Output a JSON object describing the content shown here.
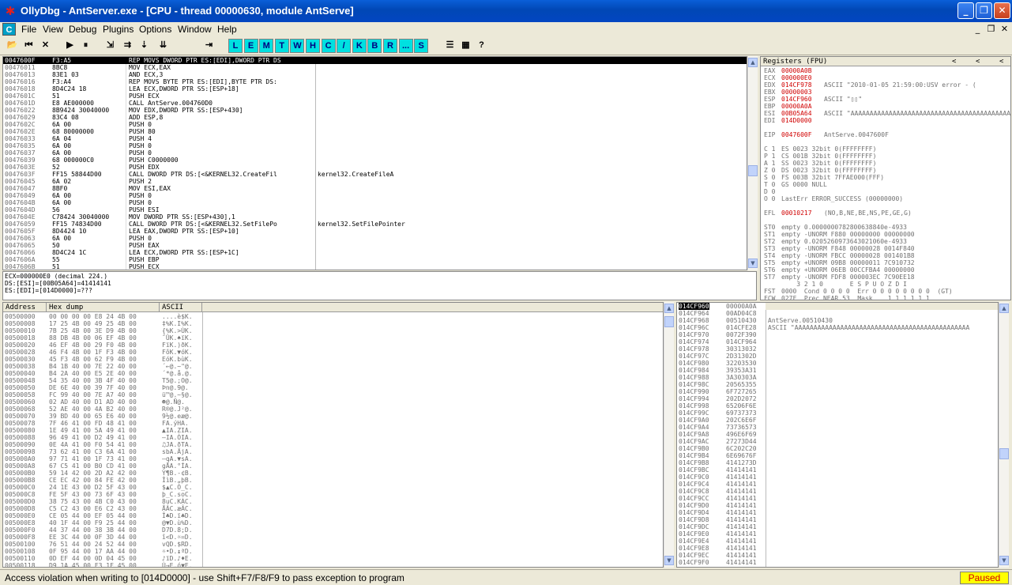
{
  "window": {
    "title": "OllyDbg - AntServer.exe - [CPU - thread 00000630, module AntServe]"
  },
  "menu": {
    "mdi_icon": "C",
    "items": [
      "File",
      "View",
      "Debug",
      "Plugins",
      "Options",
      "Window",
      "Help"
    ]
  },
  "toolbar": {
    "icon_buttons": [
      {
        "name": "open-icon",
        "glyph": "📂"
      },
      {
        "name": "restart-icon",
        "glyph": "⏮"
      },
      {
        "name": "close-program-icon",
        "glyph": "✕"
      },
      {
        "name": "run-icon",
        "glyph": "▶"
      },
      {
        "name": "pause-icon",
        "glyph": "⏸"
      },
      {
        "name": "step-into-icon",
        "glyph": "⇲"
      },
      {
        "name": "step-over-icon",
        "glyph": "⇉"
      },
      {
        "name": "trace-into-icon",
        "glyph": "⇣"
      },
      {
        "name": "trace-over-icon",
        "glyph": "⇊"
      },
      {
        "name": "execute-till-return-icon",
        "glyph": "⇥"
      }
    ],
    "window_buttons": [
      "L",
      "E",
      "M",
      "T",
      "W",
      "H",
      "C",
      "/",
      "K",
      "B",
      "R",
      "...",
      "S"
    ],
    "right_icons": [
      {
        "name": "list-icon",
        "glyph": "☰"
      },
      {
        "name": "appearance-icon",
        "glyph": "▦"
      },
      {
        "name": "help-icon",
        "glyph": "?"
      }
    ]
  },
  "disasm": {
    "rows": [
      [
        "0047600F",
        "F3:A5",
        "REP MOVS DWORD PTR ES:[EDI],DWORD PTR DS",
        ""
      ],
      [
        "00476011",
        "8BC8",
        "MOV ECX,EAX",
        ""
      ],
      [
        "00476013",
        "83E1 03",
        "AND ECX,3",
        ""
      ],
      [
        "00476016",
        "F3:A4",
        "REP MOVS BYTE PTR ES:[EDI],BYTE PTR DS:",
        ""
      ],
      [
        "00476018",
        "8D4C24 18",
        "LEA ECX,DWORD PTR SS:[ESP+18]",
        ""
      ],
      [
        "0047601C",
        "51",
        "PUSH ECX",
        ""
      ],
      [
        "0047601D",
        "E8 AE000000",
        "CALL AntServe.004760D0",
        ""
      ],
      [
        "00476022",
        "8B9424 30040000",
        "MOV EDX,DWORD PTR SS:[ESP+430]",
        ""
      ],
      [
        "00476029",
        "83C4 08",
        "ADD ESP,8",
        ""
      ],
      [
        "0047602C",
        "6A 00",
        "PUSH 0",
        ""
      ],
      [
        "0047602E",
        "68 80000000",
        "PUSH 80",
        ""
      ],
      [
        "00476033",
        "6A 04",
        "PUSH 4",
        ""
      ],
      [
        "00476035",
        "6A 00",
        "PUSH 0",
        ""
      ],
      [
        "00476037",
        "6A 00",
        "PUSH 0",
        ""
      ],
      [
        "00476039",
        "68 000000C0",
        "PUSH C0000000",
        ""
      ],
      [
        "0047603E",
        "52",
        "PUSH EDX",
        ""
      ],
      [
        "0047603F",
        "FF15 58844D00",
        "CALL DWORD PTR DS:[<&KERNEL32.CreateFil",
        "kernel32.CreateFileA"
      ],
      [
        "00476045",
        "6A 02",
        "PUSH 2",
        ""
      ],
      [
        "00476047",
        "8BF0",
        "MOV ESI,EAX",
        ""
      ],
      [
        "00476049",
        "6A 00",
        "PUSH 0",
        ""
      ],
      [
        "0047604B",
        "6A 00",
        "PUSH 0",
        ""
      ],
      [
        "0047604D",
        "56",
        "PUSH ESI",
        ""
      ],
      [
        "0047604E",
        "C78424 30040000",
        "MOV DWORD PTR SS:[ESP+430],1",
        ""
      ],
      [
        "00476059",
        "FF15 74834D00",
        "CALL DWORD PTR DS:[<&KERNEL32.SetFilePo",
        "kernel32.SetFilePointer"
      ],
      [
        "0047605F",
        "8D4424 10",
        "LEA EAX,DWORD PTR SS:[ESP+10]",
        ""
      ],
      [
        "00476063",
        "6A 00",
        "PUSH 0",
        ""
      ],
      [
        "00476065",
        "50",
        "PUSH EAX",
        ""
      ],
      [
        "00476066",
        "8D4C24 1C",
        "LEA ECX,DWORD PTR SS:[ESP+1C]",
        ""
      ],
      [
        "0047606A",
        "55",
        "PUSH EBP",
        ""
      ],
      [
        "0047606B",
        "51",
        "PUSH ECX",
        ""
      ]
    ]
  },
  "info": {
    "lines": [
      "ECX=000000E0 (decimal 224.)",
      "DS:[ESI]=[00B05A64]=41414141",
      "ES:[EDI]=[014D0000]=???"
    ]
  },
  "registers": {
    "title": "Registers (FPU)",
    "nav": [
      "<",
      "<",
      "<"
    ],
    "lines": [
      {
        "label": "EAX",
        "value": "00000A0B",
        "comment": "",
        "red": true
      },
      {
        "label": "ECX",
        "value": "000000E0",
        "comment": "",
        "red": true
      },
      {
        "label": "EDX",
        "value": "014CF978",
        "comment": "ASCII \"2010-01-05 21:59:00:USV error - (",
        "red": true
      },
      {
        "label": "EBX",
        "value": "00000003",
        "comment": "",
        "red": true
      },
      {
        "label": "ESP",
        "value": "014CF960",
        "comment": "ASCII \"▯▯\"",
        "red": true
      },
      {
        "label": "EBP",
        "value": "00000A0A",
        "comment": "",
        "red": true
      },
      {
        "label": "ESI",
        "value": "00B05A64",
        "comment": "ASCII \"AAAAAAAAAAAAAAAAAAAAAAAAAAAAAAAAAAAAAAAAAAAA",
        "red": true
      },
      {
        "label": "EDI",
        "value": "014D0000",
        "comment": "",
        "red": true
      },
      {
        "label": "",
        "value": "",
        "comment": "",
        "red": false
      },
      {
        "label": "EIP",
        "value": "0047600F",
        "comment": "AntServe.0047600F",
        "red": true
      },
      {
        "label": "",
        "value": "",
        "comment": "",
        "red": false
      },
      {
        "label": "C 1",
        "value": "",
        "comment": "ES 0023 32bit 0(FFFFFFFF)",
        "red": false
      },
      {
        "label": "P 1",
        "value": "",
        "comment": "CS 001B 32bit 0(FFFFFFFF)",
        "red": false
      },
      {
        "label": "A 1",
        "value": "",
        "comment": "SS 0023 32bit 0(FFFFFFFF)",
        "red": false
      },
      {
        "label": "Z 0",
        "value": "",
        "comment": "DS 0023 32bit 0(FFFFFFFF)",
        "red": false
      },
      {
        "label": "S 0",
        "value": "",
        "comment": "FS 003B 32bit 7FFAE000(FFF)",
        "red": false
      },
      {
        "label": "T 0",
        "value": "",
        "comment": "GS 0000 NULL",
        "red": false
      },
      {
        "label": "D 0",
        "value": "",
        "comment": "",
        "red": false
      },
      {
        "label": "O 0",
        "value": "",
        "comment": "LastErr ERROR_SUCCESS (00000000)",
        "red": false
      },
      {
        "label": "",
        "value": "",
        "comment": "",
        "red": false
      },
      {
        "label": "EFL",
        "value": "00010217",
        "comment": "(NO,B,NE,BE,NS,PE,GE,G)",
        "red": true
      },
      {
        "label": "",
        "value": "",
        "comment": "",
        "red": false
      },
      {
        "label": "ST0",
        "value": "",
        "comment": "empty 0.0000000782800638840e-4933",
        "red": false
      },
      {
        "label": "ST1",
        "value": "",
        "comment": "empty -UNORM F880 00000000 00000000",
        "red": false
      },
      {
        "label": "ST2",
        "value": "",
        "comment": "empty 0.0205260973643021060e-4933",
        "red": false
      },
      {
        "label": "ST3",
        "value": "",
        "comment": "empty -UNORM F848 00000028 0014F840",
        "red": false
      },
      {
        "label": "ST4",
        "value": "",
        "comment": "empty -UNORM FBCC 00000028 001401B8",
        "red": false
      },
      {
        "label": "ST5",
        "value": "",
        "comment": "empty +UNORM 09B8 00000011 7C910732",
        "red": false
      },
      {
        "label": "ST6",
        "value": "",
        "comment": "empty +UNORM 06EB 00CCFBA4 00000000",
        "red": false
      },
      {
        "label": "ST7",
        "value": "",
        "comment": "empty -UNORM FDF8 000003EC 7C90EE18",
        "red": false
      },
      {
        "label": "",
        "value": "",
        "comment": "    3 2 1 0       E S P U O Z D I",
        "red": false
      },
      {
        "label": "FST",
        "value": "",
        "comment": "0000  Cond 0 0 0 0  Err 0 0 0 0 0 0 0 0  (GT)",
        "red": false
      },
      {
        "label": "FCW",
        "value": "",
        "comment": "027F  Prec NEAR,53  Mask    1 1 1 1 1 1",
        "red": false
      }
    ]
  },
  "dump": {
    "headers": [
      "Address",
      "Hex dump",
      "ASCII"
    ],
    "rows": [
      [
        "00500000",
        "00 00 00 00 E8 24 4B 00",
        "....è$K."
      ],
      [
        "00500008",
        "17 25 4B 00 49 25 4B 00",
        "‡%K.I%K."
      ],
      [
        "00500010",
        "7B 25 4B 00 3E D9 4B 00",
        "{%K.>ÙK."
      ],
      [
        "00500018",
        "88 DB 4B 00 06 EF 4B 00",
        "ˆÛK.♠ïK."
      ],
      [
        "00500020",
        "46 EF 4B 00 29 F0 4B 00",
        "FïK.)ðK."
      ],
      [
        "00500028",
        "46 F4 4B 00 1F F3 4B 00",
        "FôK.▼óK."
      ],
      [
        "00500030",
        "45 F3 4B 00 62 F9 4B 00",
        "EóK.bùK."
      ],
      [
        "00500038",
        "B4 1B 40 00 7E 22 40 00",
        "´←@.~\"@."
      ],
      [
        "00500040",
        "B4 2A 40 00 E5 2E 40 00",
        "´*@.å.@."
      ],
      [
        "00500048",
        "54 35 40 00 3B 4F 40 00",
        "T5@.;O@."
      ],
      [
        "00500050",
        "DE 6E 40 00 39 7F 40 00",
        "Þn@.9@."
      ],
      [
        "00500058",
        "FC 99 40 00 7E A7 40 00",
        "ü™@.~§@."
      ],
      [
        "00500060",
        "02 AD 40 00 D1 AD 40 00",
        "☻­@.Ñ­@."
      ],
      [
        "00500068",
        "52 AE 40 00 4A B2 40 00",
        "R®@.J²@."
      ],
      [
        "00500070",
        "39 BD 40 00 65 E6 40 00",
        "9½@.eæ@."
      ],
      [
        "00500078",
        "7F 46 41 00 FD 48 41 00",
        "FA.ýHA."
      ],
      [
        "00500080",
        "1E 49 41 00 5A 49 41 00",
        "▲IA.ZIA."
      ],
      [
        "00500088",
        "96 49 41 00 D2 49 41 00",
        "–IA.ÒIA."
      ],
      [
        "00500090",
        "0E 4A 41 00 F0 54 41 00",
        "♫JA.ðTA."
      ],
      [
        "00500098",
        "73 62 41 00 C3 6A 41 00",
        "sbA.ÃjA."
      ],
      [
        "005000A0",
        "97 71 41 00 1F 73 41 00",
        "—qA.▼sA."
      ],
      [
        "005000A8",
        "67 C5 41 00 B0 CD 41 00",
        "gÅA.°ÍA."
      ],
      [
        "005000B0",
        "59 14 42 00 2D A2 42 00",
        "Y¶B.-¢B."
      ],
      [
        "005000B8",
        "CE EC 42 00 84 FE 42 00",
        "ÎìB.„þB."
      ],
      [
        "005000C0",
        "24 1E 43 00 D2 5F 43 00",
        "$▲C.Ò_C."
      ],
      [
        "005000C8",
        "FE 5F 43 00 73 6F 43 00",
        "þ_C.soC."
      ],
      [
        "005000D0",
        "38 75 43 00 4B C0 43 00",
        "8uC.KÀC."
      ],
      [
        "005000D8",
        "C5 C2 43 00 E6 C2 43 00",
        "ÅÂC.æÂC."
      ],
      [
        "005000E0",
        "CE 05 44 00 EF 05 44 00",
        "Î♣D.ï♣D."
      ],
      [
        "005000E8",
        "40 1F 44 00 F9 25 44 00",
        "@▼D.ù%D."
      ],
      [
        "005000F0",
        "44 37 44 00 38 3B 44 00",
        "D7D.8;D."
      ],
      [
        "005000F8",
        "EE 3C 44 00 0F 3D 44 00",
        "î<D.☼=D."
      ],
      [
        "00500100",
        "76 51 44 00 24 52 44 00",
        "vQD.$RD."
      ],
      [
        "00500108",
        "0F 95 44 00 17 AA 44 00",
        "☼•D.↨ªD."
      ],
      [
        "00500110",
        "0D EF 44 00 0D 04 45 00",
        "♪ïD.♪♦E."
      ],
      [
        "00500118",
        "D9 1A 45 00 F3 1F 45 00",
        "Ù→E.ó▼E."
      ]
    ]
  },
  "stack": {
    "rows": [
      [
        "014CF960",
        "00000A0A",
        ""
      ],
      [
        "014CF964",
        "00AD04C8",
        ""
      ],
      [
        "014CF968",
        "00510430",
        "AntServe.00510430"
      ],
      [
        "014CF96C",
        "014CFE28",
        "ASCII \"AAAAAAAAAAAAAAAAAAAAAAAAAAAAAAAAAAAAAAAAAAAAAA"
      ],
      [
        "014CF970",
        "0072F390",
        ""
      ],
      [
        "014CF974",
        "014CF964",
        ""
      ],
      [
        "014CF978",
        "30313032",
        ""
      ],
      [
        "014CF97C",
        "2D31302D",
        ""
      ],
      [
        "014CF980",
        "32203530",
        ""
      ],
      [
        "014CF984",
        "39353A31",
        ""
      ],
      [
        "014CF988",
        "3A30303A",
        ""
      ],
      [
        "014CF98C",
        "20565355",
        ""
      ],
      [
        "014CF990",
        "6F727265",
        ""
      ],
      [
        "014CF994",
        "202D2072",
        ""
      ],
      [
        "014CF998",
        "65206F6E",
        ""
      ],
      [
        "014CF99C",
        "69737373",
        ""
      ],
      [
        "014CF9A0",
        "202C6E6F",
        ""
      ],
      [
        "014CF9A4",
        "73736573",
        ""
      ],
      [
        "014CF9A8",
        "496E6F69",
        ""
      ],
      [
        "014CF9AC",
        "27273D44",
        ""
      ],
      [
        "014CF9B0",
        "6C202C20",
        ""
      ],
      [
        "014CF9B4",
        "6E69676F",
        ""
      ],
      [
        "014CF9B8",
        "4141273D",
        ""
      ],
      [
        "014CF9BC",
        "41414141",
        ""
      ],
      [
        "014CF9C0",
        "41414141",
        ""
      ],
      [
        "014CF9C4",
        "41414141",
        ""
      ],
      [
        "014CF9C8",
        "41414141",
        ""
      ],
      [
        "014CF9CC",
        "41414141",
        ""
      ],
      [
        "014CF9D0",
        "41414141",
        ""
      ],
      [
        "014CF9D4",
        "41414141",
        ""
      ],
      [
        "014CF9D8",
        "41414141",
        ""
      ],
      [
        "014CF9DC",
        "41414141",
        ""
      ],
      [
        "014CF9E0",
        "41414141",
        ""
      ],
      [
        "014CF9E4",
        "41414141",
        ""
      ],
      [
        "014CF9E8",
        "41414141",
        ""
      ],
      [
        "014CF9EC",
        "41414141",
        ""
      ],
      [
        "014CF9F0",
        "41414141",
        ""
      ]
    ]
  },
  "status": {
    "message": "Access violation when writing to [014D0000] - use Shift+F7/F8/F9 to pass exception to program",
    "state": "Paused"
  },
  "colors": {
    "titlebar": "#0147b5",
    "selection": "#000000",
    "highlight": "#d00000",
    "status_state_bg": "#ffff00"
  }
}
